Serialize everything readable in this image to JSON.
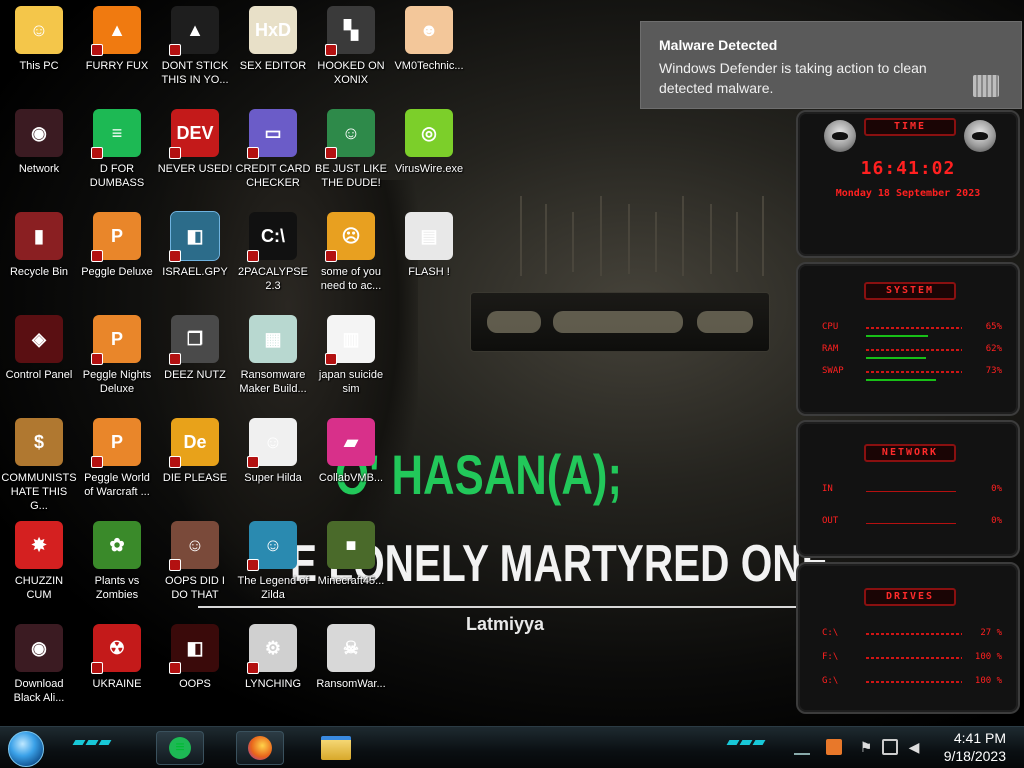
{
  "desktop": {
    "icons": [
      {
        "label": "This PC",
        "col": 0,
        "row": 0,
        "color": "#f4c64a",
        "glyph": "☺",
        "shortcut": false
      },
      {
        "label": "FURRY FUX",
        "col": 1,
        "row": 0,
        "color": "#f07a10",
        "glyph": "▲",
        "shortcut": true
      },
      {
        "label": "DONT STICK THIS IN YO...",
        "col": 2,
        "row": 0,
        "color": "#1e1e1e",
        "glyph": "▲",
        "shortcut": true
      },
      {
        "label": "SEX EDITOR",
        "col": 3,
        "row": 0,
        "color": "#e8e0c8",
        "glyph": "HxD",
        "shortcut": false
      },
      {
        "label": "HOOKED ON XONIX",
        "col": 4,
        "row": 0,
        "color": "#3a3a3a",
        "glyph": "▚",
        "shortcut": true
      },
      {
        "label": "VM0Technic...",
        "col": 5,
        "row": 0,
        "color": "#f3c79a",
        "glyph": "☻",
        "shortcut": false
      },
      {
        "label": "Network",
        "col": 0,
        "row": 1,
        "color": "#3b1b22",
        "glyph": "◉",
        "shortcut": false
      },
      {
        "label": "D FOR DUMBASS",
        "col": 1,
        "row": 1,
        "color": "#1db954",
        "glyph": "≡",
        "shortcut": true
      },
      {
        "label": "NEVER USED!",
        "col": 2,
        "row": 1,
        "color": "#c41a1a",
        "glyph": "DEV",
        "shortcut": true
      },
      {
        "label": "CREDIT CARD CHECKER",
        "col": 3,
        "row": 1,
        "color": "#6b5cc8",
        "glyph": "▭",
        "shortcut": true
      },
      {
        "label": "BE JUST LIKE THE DUDE!",
        "col": 4,
        "row": 1,
        "color": "#2e8a4a",
        "glyph": "☺",
        "shortcut": true
      },
      {
        "label": "VirusWire.exe",
        "col": 5,
        "row": 1,
        "color": "#7ccf2a",
        "glyph": "◎",
        "shortcut": false
      },
      {
        "label": "Recycle Bin",
        "col": 0,
        "row": 2,
        "color": "#8a1f22",
        "glyph": "▮",
        "shortcut": false
      },
      {
        "label": "Peggle Deluxe",
        "col": 1,
        "row": 2,
        "color": "#e9862a",
        "glyph": "P",
        "shortcut": true
      },
      {
        "label": "ISRAEL.GPY",
        "col": 2,
        "row": 2,
        "color": "#2c6c8a",
        "glyph": "◧",
        "shortcut": true
      },
      {
        "label": "2PACALYPSE 2.3",
        "col": 3,
        "row": 2,
        "color": "#111111",
        "glyph": "C:\\",
        "shortcut": true
      },
      {
        "label": "some of you need to ac...",
        "col": 4,
        "row": 2,
        "color": "#e8a020",
        "glyph": "☹",
        "shortcut": true
      },
      {
        "label": "FLASH !",
        "col": 5,
        "row": 2,
        "color": "#e8e8e8",
        "glyph": "▤",
        "shortcut": false
      },
      {
        "label": "Control Panel",
        "col": 0,
        "row": 3,
        "color": "#5a0f12",
        "glyph": "◈",
        "shortcut": false
      },
      {
        "label": "Peggle Nights Deluxe",
        "col": 1,
        "row": 3,
        "color": "#e9862a",
        "glyph": "P",
        "shortcut": true
      },
      {
        "label": "DEEZ NUTZ",
        "col": 2,
        "row": 3,
        "color": "#4a4a4a",
        "glyph": "❐",
        "shortcut": true
      },
      {
        "label": "Ransomware Maker Build...",
        "col": 3,
        "row": 3,
        "color": "#b8d8d0",
        "glyph": "▦",
        "shortcut": false
      },
      {
        "label": "japan suicide sim",
        "col": 4,
        "row": 3,
        "color": "#f4f4f4",
        "glyph": "▥",
        "shortcut": true
      },
      {
        "label": "COMMUNISTS HATE THIS G...",
        "col": 0,
        "row": 4,
        "color": "#b07830",
        "glyph": "$",
        "shortcut": false
      },
      {
        "label": "Peggle World of Warcraft ...",
        "col": 1,
        "row": 4,
        "color": "#e9862a",
        "glyph": "P",
        "shortcut": true
      },
      {
        "label": "DIE PLEASE",
        "col": 2,
        "row": 4,
        "color": "#e8a21a",
        "glyph": "De",
        "shortcut": true
      },
      {
        "label": "Super Hilda",
        "col": 3,
        "row": 4,
        "color": "#f0f0f0",
        "glyph": "☺",
        "shortcut": true
      },
      {
        "label": "CollabVMB...",
        "col": 4,
        "row": 4,
        "color": "#d8308a",
        "glyph": "▰",
        "shortcut": false
      },
      {
        "label": "CHUZZIN CUM",
        "col": 0,
        "row": 5,
        "color": "#d42020",
        "glyph": "✸",
        "shortcut": false
      },
      {
        "label": "Plants vs Zombies",
        "col": 1,
        "row": 5,
        "color": "#3a8a2a",
        "glyph": "✿",
        "shortcut": false
      },
      {
        "label": "OOPS DID I DO THAT",
        "col": 2,
        "row": 5,
        "color": "#7a4a3a",
        "glyph": "☺",
        "shortcut": true
      },
      {
        "label": "The Legend of Zilda",
        "col": 3,
        "row": 5,
        "color": "#2a8ab0",
        "glyph": "☺",
        "shortcut": true
      },
      {
        "label": "Minecraft45...",
        "col": 4,
        "row": 5,
        "color": "#4a6a2a",
        "glyph": "■",
        "shortcut": false
      },
      {
        "label": "Download Black Ali...",
        "col": 0,
        "row": 6,
        "color": "#3b1b22",
        "glyph": "◉",
        "shortcut": false
      },
      {
        "label": "UKRAINE",
        "col": 1,
        "row": 6,
        "color": "#c41a1a",
        "glyph": "☢",
        "shortcut": true
      },
      {
        "label": "OOPS",
        "col": 2,
        "row": 6,
        "color": "#3a0a0a",
        "glyph": "◧",
        "shortcut": true
      },
      {
        "label": "LYNCHING",
        "col": 3,
        "row": 6,
        "color": "#d0d0d0",
        "glyph": "⚙",
        "shortcut": true
      },
      {
        "label": "RansomWar...",
        "col": 4,
        "row": 6,
        "color": "#d8d8d8",
        "glyph": "☠",
        "shortcut": false
      }
    ]
  },
  "wallpaper": {
    "title": "O' HASAN(A);",
    "subtitle": "E LONELY MARTYRED ONE",
    "caption": "Latmiyya"
  },
  "toast": {
    "title": "Malware Detected",
    "body": "Windows Defender is taking action to clean detected malware."
  },
  "gadgets": {
    "time": {
      "header": "TIME",
      "clock": "16:41:02",
      "date": "Monday 18 September 2023"
    },
    "system": {
      "header": "SYSTEM",
      "rows": [
        {
          "label": "CPU",
          "value": "65%",
          "fraction": 0.65
        },
        {
          "label": "RAM",
          "value": "62%",
          "fraction": 0.62
        },
        {
          "label": "SWAP",
          "value": "73%",
          "fraction": 0.73
        }
      ]
    },
    "network": {
      "header": "NETWORK",
      "rows": [
        {
          "label": "IN",
          "value": "0%"
        },
        {
          "label": "OUT",
          "value": "0%"
        }
      ]
    },
    "drives": {
      "header": "DRIVES",
      "rows": [
        {
          "label": "C:\\",
          "value": "27 %"
        },
        {
          "label": "F:\\",
          "value": "100 %"
        },
        {
          "label": "G:\\",
          "value": "100 %"
        }
      ]
    }
  },
  "taskbar": {
    "pinned": [
      {
        "name": "spotify",
        "color": "#1db954"
      },
      {
        "name": "firefox",
        "color": "#e8641a"
      },
      {
        "name": "file-explorer",
        "color": "#e8c24a"
      }
    ],
    "clock_time": "4:41 PM",
    "clock_date": "9/18/2023"
  },
  "colors": {
    "accent_red": "#ff2020",
    "wallpaper_green": "#22c85a",
    "taskbar_cyan": "#18c8d8"
  }
}
